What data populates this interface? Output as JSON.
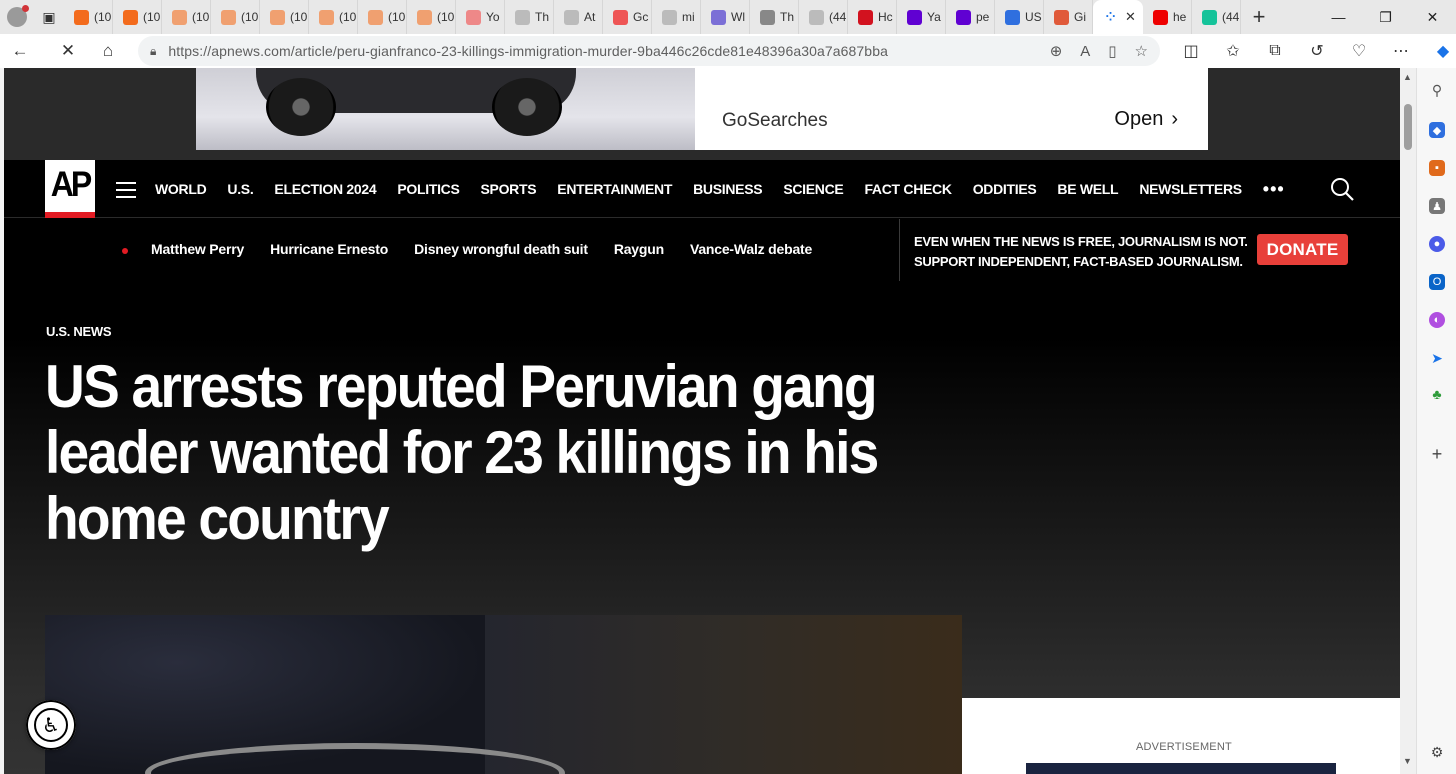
{
  "browser": {
    "tabs": [
      {
        "label": "(10",
        "favicon": "bookmark-icon",
        "color": "#f36b1c"
      },
      {
        "label": "(10",
        "favicon": "bookmark-icon",
        "color": "#f36b1c"
      },
      {
        "label": "(10",
        "favicon": "bookmark-icon",
        "color": "#f0a070"
      },
      {
        "label": "(10",
        "favicon": "bookmark-icon",
        "color": "#f0a070"
      },
      {
        "label": "(10",
        "favicon": "bookmark-icon",
        "color": "#f0a070"
      },
      {
        "label": "(10",
        "favicon": "bookmark-icon",
        "color": "#f0a070"
      },
      {
        "label": "(10",
        "favicon": "bookmark-icon",
        "color": "#f0a070"
      },
      {
        "label": "(10",
        "favicon": "bookmark-icon",
        "color": "#f0a070"
      },
      {
        "label": "Yo",
        "favicon": "youtube-icon",
        "color": "#e88"
      },
      {
        "label": "Th",
        "favicon": "page-icon",
        "color": "#bbb"
      },
      {
        "label": "At",
        "favicon": "page-icon",
        "color": "#bbb"
      },
      {
        "label": "Gc",
        "favicon": "youtube-icon",
        "color": "#e55"
      },
      {
        "label": "mi",
        "favicon": "page-icon",
        "color": "#bbb"
      },
      {
        "label": "Wl",
        "favicon": "shield-icon",
        "color": "#7b6fd6"
      },
      {
        "label": "Th",
        "favicon": "grid-icon",
        "color": "#888"
      },
      {
        "label": "(44",
        "favicon": "page-icon",
        "color": "#bbb"
      },
      {
        "label": "Hc",
        "favicon": "alert-icon",
        "color": "#d2121f"
      },
      {
        "label": "Ya",
        "favicon": "yahoo-icon",
        "color": "#6001d2"
      },
      {
        "label": "pe",
        "favicon": "yahoo-icon",
        "color": "#6001d2"
      },
      {
        "label": "US",
        "favicon": "aol-icon",
        "color": "#2f6fdf"
      },
      {
        "label": "Gi",
        "favicon": "news-icon",
        "color": "#e05a3a"
      }
    ],
    "active_tab": {
      "favicon": "loading-icon"
    },
    "tabs_after": [
      {
        "label": "he",
        "favicon": "youtube-icon",
        "color": "#e00"
      },
      {
        "label": "(44",
        "favicon": "grammarly-icon",
        "color": "#15c39a"
      }
    ],
    "url": "https://apnews.com/article/peru-gianfranco-23-killings-immigration-murder-9ba446c26cde81e48396a30a7a687bba"
  },
  "ad_top": {
    "brand": "GoSearches",
    "cta": "Open"
  },
  "nav": {
    "logo": "AP",
    "items": [
      "WORLD",
      "U.S.",
      "ELECTION 2024",
      "POLITICS",
      "SPORTS",
      "ENTERTAINMENT",
      "BUSINESS",
      "SCIENCE",
      "FACT CHECK",
      "ODDITIES",
      "BE WELL",
      "NEWSLETTERS"
    ],
    "more": "•••"
  },
  "trending": {
    "items": [
      "Matthew Perry",
      "Hurricane Ernesto",
      "Disney wrongful death suit",
      "Raygun",
      "Vance-Walz debate"
    ]
  },
  "donate": {
    "line1": "EVEN WHEN THE NEWS IS FREE, JOURNALISM IS NOT.",
    "line2": "SUPPORT INDEPENDENT, FACT-BASED JOURNALISM.",
    "button": "DONATE"
  },
  "article": {
    "section": "U.S. NEWS",
    "headline": "US arrests reputed Peruvian gang leader wanted for 23 killings in his home country"
  },
  "advertisement_label": "ADVERTISEMENT",
  "colors": {
    "accent_red": "#e21b23",
    "donate_red": "#e8403a",
    "page_bg": "#000000"
  }
}
